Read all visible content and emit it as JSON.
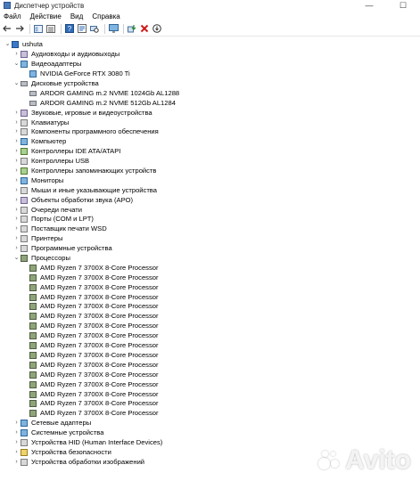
{
  "window": {
    "title": "Диспетчер устройств",
    "minimize": "—",
    "maximize": "☐"
  },
  "menu": [
    "Файл",
    "Действие",
    "Вид",
    "Справка"
  ],
  "tree": [
    {
      "label": "ushuta",
      "level": 0,
      "expanded": true,
      "icon": "root"
    },
    {
      "label": "Аудиовходы и аудиовыходы",
      "level": 1,
      "expanded": false,
      "icon": "sound"
    },
    {
      "label": "Видеоадаптеры",
      "level": 1,
      "expanded": true,
      "icon": "monitor"
    },
    {
      "label": "NVIDIA GeForce RTX 3080 Ti",
      "level": 2,
      "icon": "monitor"
    },
    {
      "label": "Дисковые устройства",
      "level": 1,
      "expanded": true,
      "icon": "disk"
    },
    {
      "label": "ARDOR GAMING m.2 NVME 1024Gb AL1288",
      "level": 2,
      "icon": "disk"
    },
    {
      "label": "ARDOR GAMING m.2 NVME 512Gb AL1284",
      "level": 2,
      "icon": "disk"
    },
    {
      "label": "Звуковые, игровые и видеоустройства",
      "level": 1,
      "expanded": false,
      "icon": "sound"
    },
    {
      "label": "Клавиатуры",
      "level": 1,
      "expanded": false,
      "icon": "grey"
    },
    {
      "label": "Компоненты программного обеспечения",
      "level": 1,
      "expanded": false,
      "icon": "grey"
    },
    {
      "label": "Компьютер",
      "level": 1,
      "expanded": false,
      "icon": "monitor"
    },
    {
      "label": "Контроллеры IDE ATA/ATAPI",
      "level": 1,
      "expanded": false,
      "icon": "green"
    },
    {
      "label": "Контроллеры USB",
      "level": 1,
      "expanded": false,
      "icon": "grey"
    },
    {
      "label": "Контроллеры запоминающих устройств",
      "level": 1,
      "expanded": false,
      "icon": "green"
    },
    {
      "label": "Мониторы",
      "level": 1,
      "expanded": false,
      "icon": "monitor"
    },
    {
      "label": "Мыши и иные указывающие устройства",
      "level": 1,
      "expanded": false,
      "icon": "grey"
    },
    {
      "label": "Объекты обработки звука (APO)",
      "level": 1,
      "expanded": false,
      "icon": "sound"
    },
    {
      "label": "Очереди печати",
      "level": 1,
      "expanded": false,
      "icon": "grey"
    },
    {
      "label": "Порты (COM и LPT)",
      "level": 1,
      "expanded": false,
      "icon": "grey"
    },
    {
      "label": "Поставщик печати WSD",
      "level": 1,
      "expanded": false,
      "icon": "grey"
    },
    {
      "label": "Принтеры",
      "level": 1,
      "expanded": false,
      "icon": "grey"
    },
    {
      "label": "Программные устройства",
      "level": 1,
      "expanded": false,
      "icon": "grey"
    },
    {
      "label": "Процессоры",
      "level": 1,
      "expanded": true,
      "icon": "cpu"
    },
    {
      "label": "AMD Ryzen 7 3700X 8-Core Processor",
      "level": 2,
      "icon": "cpu"
    },
    {
      "label": "AMD Ryzen 7 3700X 8-Core Processor",
      "level": 2,
      "icon": "cpu"
    },
    {
      "label": "AMD Ryzen 7 3700X 8-Core Processor",
      "level": 2,
      "icon": "cpu"
    },
    {
      "label": "AMD Ryzen 7 3700X 8-Core Processor",
      "level": 2,
      "icon": "cpu"
    },
    {
      "label": "AMD Ryzen 7 3700X 8-Core Processor",
      "level": 2,
      "icon": "cpu"
    },
    {
      "label": "AMD Ryzen 7 3700X 8-Core Processor",
      "level": 2,
      "icon": "cpu"
    },
    {
      "label": "AMD Ryzen 7 3700X 8-Core Processor",
      "level": 2,
      "icon": "cpu"
    },
    {
      "label": "AMD Ryzen 7 3700X 8-Core Processor",
      "level": 2,
      "icon": "cpu"
    },
    {
      "label": "AMD Ryzen 7 3700X 8-Core Processor",
      "level": 2,
      "icon": "cpu"
    },
    {
      "label": "AMD Ryzen 7 3700X 8-Core Processor",
      "level": 2,
      "icon": "cpu"
    },
    {
      "label": "AMD Ryzen 7 3700X 8-Core Processor",
      "level": 2,
      "icon": "cpu"
    },
    {
      "label": "AMD Ryzen 7 3700X 8-Core Processor",
      "level": 2,
      "icon": "cpu"
    },
    {
      "label": "AMD Ryzen 7 3700X 8-Core Processor",
      "level": 2,
      "icon": "cpu"
    },
    {
      "label": "AMD Ryzen 7 3700X 8-Core Processor",
      "level": 2,
      "icon": "cpu"
    },
    {
      "label": "AMD Ryzen 7 3700X 8-Core Processor",
      "level": 2,
      "icon": "cpu"
    },
    {
      "label": "AMD Ryzen 7 3700X 8-Core Processor",
      "level": 2,
      "icon": "cpu"
    },
    {
      "label": "Сетевые адаптеры",
      "level": 1,
      "expanded": false,
      "icon": "monitor"
    },
    {
      "label": "Системные устройства",
      "level": 1,
      "expanded": false,
      "icon": "monitor"
    },
    {
      "label": "Устройства HID (Human Interface Devices)",
      "level": 1,
      "expanded": false,
      "icon": "grey"
    },
    {
      "label": "Устройства безопасности",
      "level": 1,
      "expanded": false,
      "icon": "yellow"
    },
    {
      "label": "Устройства обработки изображений",
      "level": 1,
      "expanded": false,
      "icon": "grey"
    }
  ],
  "watermark": {
    "text": "Avito"
  }
}
